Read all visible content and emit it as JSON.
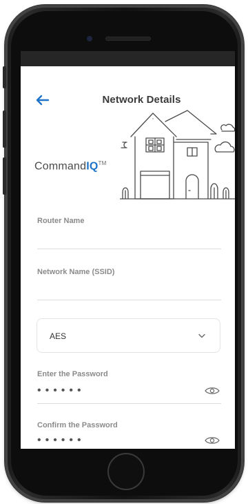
{
  "header": {
    "title": "Network Details",
    "back_icon": "arrow-left-icon",
    "accent_color": "#1e73c9"
  },
  "brand": {
    "prefix": "Command",
    "suffix": "IQ",
    "mark": "TM"
  },
  "illustration": {
    "icon": "house-illustration"
  },
  "form": {
    "router_name": {
      "label": "Router Name",
      "value": ""
    },
    "network_name": {
      "label": "Network Name (SSID)",
      "value": ""
    },
    "security": {
      "selected": "AES",
      "icon": "chevron-down-icon"
    },
    "password": {
      "label": "Enter the Password",
      "masked_value": "••••••",
      "icon": "eye-icon"
    },
    "confirm_password": {
      "label": "Confirm the Password",
      "masked_value": "••••••",
      "icon": "eye-icon"
    }
  }
}
